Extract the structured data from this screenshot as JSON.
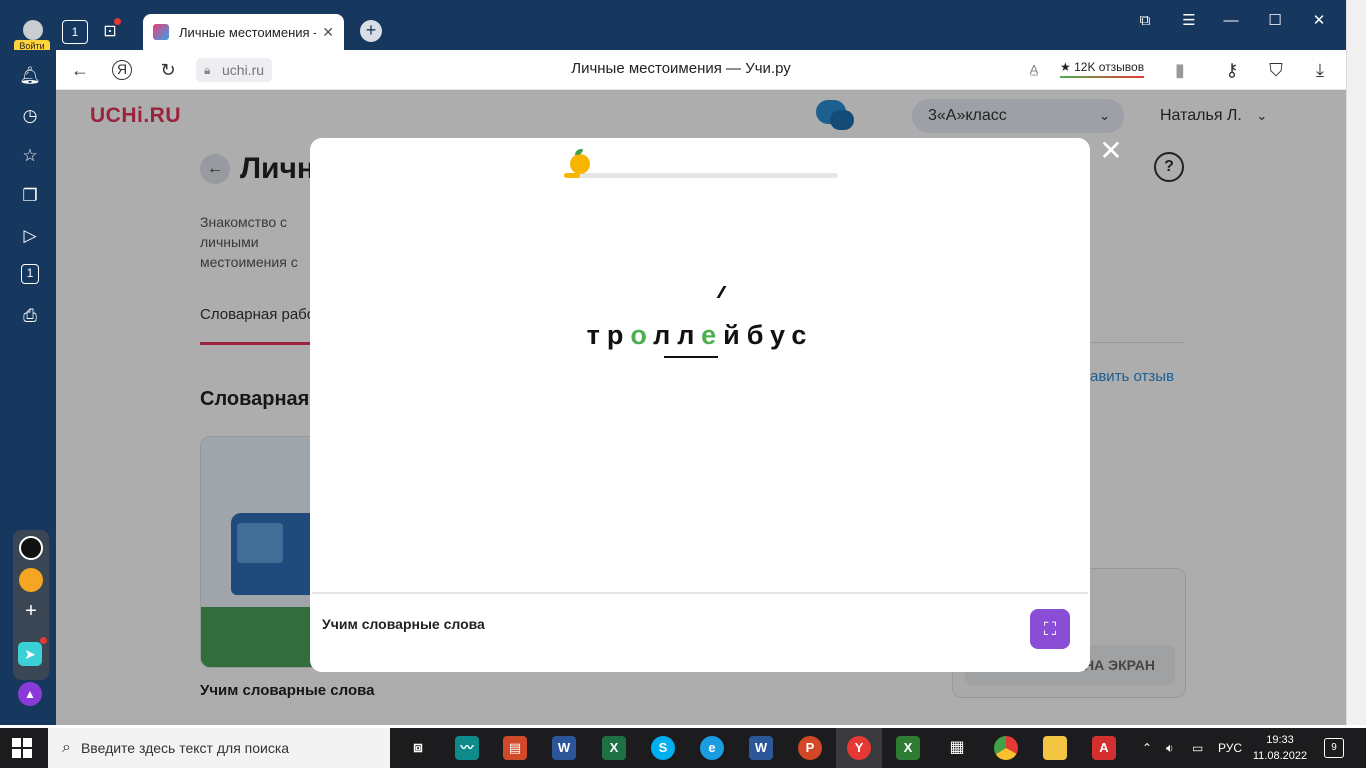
{
  "browser": {
    "login_label": "Войти",
    "tab_title": "Личные местоимения - Учи.ру",
    "home_label": "1",
    "url_host": "uchi.ru",
    "page_title": "Личные местоимения — Учи.ру",
    "reviews_label": "★ 12K отзывов",
    "sidebar_counter": "1"
  },
  "site": {
    "logo": "UCHi.RU",
    "class_select": "3«А»класс",
    "user_name": "Наталья Л.",
    "heading": "Личные местоимения",
    "description": "Знакомство с личными местоимения с",
    "help": "?",
    "tab_label": "Словарная работа",
    "feedback_link": "авить отзыв",
    "section_title": "Словарная работа",
    "card_title": "Учим словарные слова",
    "side_button": "НА ЭКРАН"
  },
  "modal": {
    "progress_fraction": 0.06,
    "word_plain_1": "тр",
    "word_hl_1": "о",
    "word_plain_2": "лл",
    "word_hl_2": "е",
    "word_plain_3": "йбус",
    "footer_title": "Учим словарные слова",
    "close_label": "✕"
  },
  "taskbar": {
    "search_placeholder": "Введите здесь текст для поиска",
    "language": "РУС",
    "time": "19:33",
    "date": "11.08.2022",
    "notifications": "9"
  },
  "colors": {
    "brand": "#e5345a",
    "browser_chrome": "#16375e",
    "highlight_letter": "#4caf50",
    "present_button": "#8a4dd6"
  }
}
